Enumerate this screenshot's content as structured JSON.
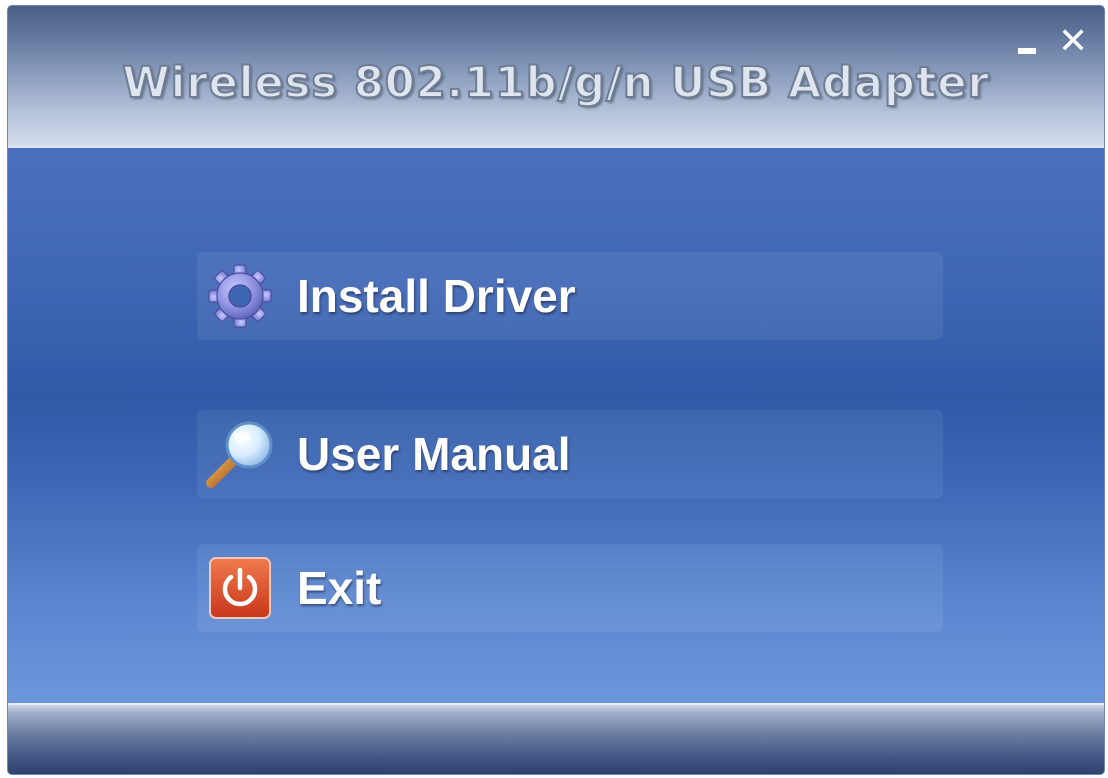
{
  "window": {
    "title": "Wireless 802.11b/g/n USB Adapter",
    "minimize_label": "minimize",
    "close_label": "close"
  },
  "menu": {
    "items": [
      {
        "label": "Install Driver",
        "icon": "gear-icon"
      },
      {
        "label": "User Manual",
        "icon": "magnifier-icon"
      },
      {
        "label": "Exit",
        "icon": "power-icon"
      }
    ]
  },
  "colors": {
    "accent_blue": "#3d63ad",
    "exit_red": "#d9441f",
    "gear_purple": "#8c90e0"
  }
}
